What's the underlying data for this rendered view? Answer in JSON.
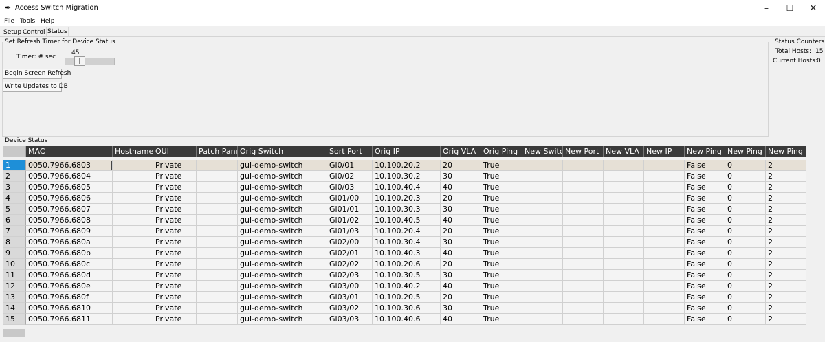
{
  "window": {
    "title": "Access Switch Migration",
    "icon": "feather-icon"
  },
  "menu": [
    "File",
    "Tools",
    "Help"
  ],
  "tabs": [
    "Setup",
    "Control",
    "Status"
  ],
  "active_tab": "Status",
  "refresh_group": {
    "label": "Set Refresh Timer for Device Status",
    "timer_label": "Timer: # sec",
    "timer_value": "45",
    "begin_button": "Begin Screen Refresh",
    "write_button": "Write Updates to DB"
  },
  "counters": {
    "label": "Status Counters",
    "total_label": "Total Hosts:",
    "total_value": "15",
    "current_label": "Current Hosts:",
    "current_value": "0"
  },
  "device_status": {
    "label": "Device Status",
    "columns": [
      "",
      "MAC",
      "Hostname",
      "OUI",
      "Patch Pane",
      "Orig Switch",
      "Sort Port",
      "Orig IP",
      "Orig VLA",
      "Orig Ping",
      "New Switc",
      "New Port",
      "New VLA",
      "New IP",
      "New Ping",
      "New Ping",
      "New Ping"
    ],
    "rows": [
      [
        "1",
        "0050.7966.6803",
        "",
        "Private",
        "",
        "gui-demo-switch",
        "Gi0/01",
        "10.100.20.2",
        "20",
        "True",
        "",
        "",
        "",
        "",
        "False",
        "0",
        "2"
      ],
      [
        "2",
        "0050.7966.6804",
        "",
        "Private",
        "",
        "gui-demo-switch",
        "Gi0/02",
        "10.100.30.2",
        "30",
        "True",
        "",
        "",
        "",
        "",
        "False",
        "0",
        "2"
      ],
      [
        "3",
        "0050.7966.6805",
        "",
        "Private",
        "",
        "gui-demo-switch",
        "Gi0/03",
        "10.100.40.4",
        "40",
        "True",
        "",
        "",
        "",
        "",
        "False",
        "0",
        "2"
      ],
      [
        "4",
        "0050.7966.6806",
        "",
        "Private",
        "",
        "gui-demo-switch",
        "Gi01/00",
        "10.100.20.3",
        "20",
        "True",
        "",
        "",
        "",
        "",
        "False",
        "0",
        "2"
      ],
      [
        "5",
        "0050.7966.6807",
        "",
        "Private",
        "",
        "gui-demo-switch",
        "Gi01/01",
        "10.100.30.3",
        "30",
        "True",
        "",
        "",
        "",
        "",
        "False",
        "0",
        "2"
      ],
      [
        "6",
        "0050.7966.6808",
        "",
        "Private",
        "",
        "gui-demo-switch",
        "Gi01/02",
        "10.100.40.5",
        "40",
        "True",
        "",
        "",
        "",
        "",
        "False",
        "0",
        "2"
      ],
      [
        "7",
        "0050.7966.6809",
        "",
        "Private",
        "",
        "gui-demo-switch",
        "Gi01/03",
        "10.100.20.4",
        "20",
        "True",
        "",
        "",
        "",
        "",
        "False",
        "0",
        "2"
      ],
      [
        "8",
        "0050.7966.680a",
        "",
        "Private",
        "",
        "gui-demo-switch",
        "Gi02/00",
        "10.100.30.4",
        "30",
        "True",
        "",
        "",
        "",
        "",
        "False",
        "0",
        "2"
      ],
      [
        "9",
        "0050.7966.680b",
        "",
        "Private",
        "",
        "gui-demo-switch",
        "Gi02/01",
        "10.100.40.3",
        "40",
        "True",
        "",
        "",
        "",
        "",
        "False",
        "0",
        "2"
      ],
      [
        "10",
        "0050.7966.680c",
        "",
        "Private",
        "",
        "gui-demo-switch",
        "Gi02/02",
        "10.100.20.6",
        "20",
        "True",
        "",
        "",
        "",
        "",
        "False",
        "0",
        "2"
      ],
      [
        "11",
        "0050.7966.680d",
        "",
        "Private",
        "",
        "gui-demo-switch",
        "Gi02/03",
        "10.100.30.5",
        "30",
        "True",
        "",
        "",
        "",
        "",
        "False",
        "0",
        "2"
      ],
      [
        "12",
        "0050.7966.680e",
        "",
        "Private",
        "",
        "gui-demo-switch",
        "Gi03/00",
        "10.100.40.2",
        "40",
        "True",
        "",
        "",
        "",
        "",
        "False",
        "0",
        "2"
      ],
      [
        "13",
        "0050.7966.680f",
        "",
        "Private",
        "",
        "gui-demo-switch",
        "Gi03/01",
        "10.100.20.5",
        "20",
        "True",
        "",
        "",
        "",
        "",
        "False",
        "0",
        "2"
      ],
      [
        "14",
        "0050.7966.6810",
        "",
        "Private",
        "",
        "gui-demo-switch",
        "Gi03/02",
        "10.100.30.6",
        "30",
        "True",
        "",
        "",
        "",
        "",
        "False",
        "0",
        "2"
      ],
      [
        "15",
        "0050.7966.6811",
        "",
        "Private",
        "",
        "gui-demo-switch",
        "Gi03/03",
        "10.100.40.6",
        "40",
        "True",
        "",
        "",
        "",
        "",
        "False",
        "0",
        "2"
      ]
    ]
  }
}
